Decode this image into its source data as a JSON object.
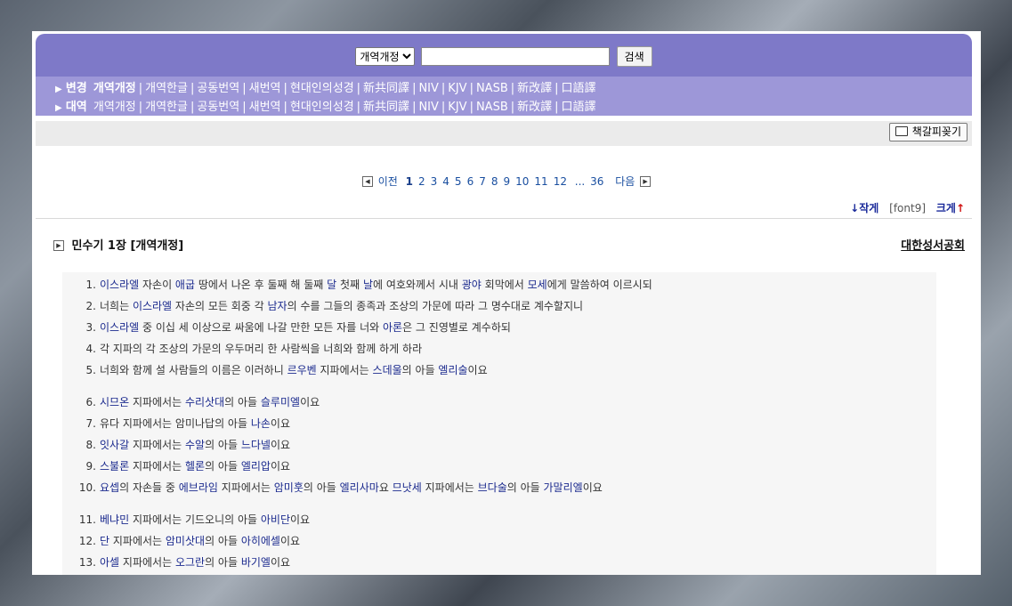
{
  "search": {
    "version_options": [
      "개역개정"
    ],
    "selected_version": "개역개정",
    "query": "",
    "button_label": "검색"
  },
  "nav": {
    "row1_label": "변경",
    "row1_selected": "개역개정",
    "row2_label": "대역",
    "versions": [
      "개역개정",
      "개역한글",
      "공동번역",
      "새번역",
      "현대인의성경",
      "新共同譯",
      "NIV",
      "KJV",
      "NASB",
      "新改譯",
      "口語譯"
    ]
  },
  "bookmark_label": "책갈피꽂기",
  "pager": {
    "prev": "이전",
    "pages": [
      "1",
      "2",
      "3",
      "4",
      "5",
      "6",
      "7",
      "8",
      "9",
      "10",
      "11",
      "12"
    ],
    "ellipsis": "...",
    "last": "36",
    "next": "다음",
    "current": "1"
  },
  "font_control": {
    "smaller": "↓작게",
    "current": "[font9]",
    "bigger": "크게"
  },
  "chapter_title": "민수기 1장 [개역개정]",
  "publisher": "대한성서공회",
  "verses": [
    {
      "num": "1.",
      "parts": [
        [
          "이스라엘",
          1
        ],
        [
          " 자손이 ",
          0
        ],
        [
          "애굽",
          1
        ],
        [
          " 땅에서 나온 후 둘째 해 둘째 ",
          0
        ],
        [
          "달",
          1
        ],
        [
          " 첫째 ",
          0
        ],
        [
          "날",
          1
        ],
        [
          "에 여호와께서 시내 ",
          0
        ],
        [
          "광야",
          1
        ],
        [
          " 회막에서 ",
          0
        ],
        [
          "모세",
          1
        ],
        [
          "에게 말씀하여 이르시되",
          0
        ]
      ]
    },
    {
      "num": "2.",
      "parts": [
        [
          "너희는 ",
          0
        ],
        [
          "이스라엘",
          1
        ],
        [
          " 자손의 모든 회중 각 ",
          0
        ],
        [
          "남자",
          1
        ],
        [
          "의 수를 그들의 종족과 조상의 가문에 따라 그 명수대로 계수할지니",
          0
        ]
      ]
    },
    {
      "num": "3.",
      "parts": [
        [
          "이스라엘",
          1
        ],
        [
          " 중 이십 세 이상으로 싸움에 나갈 만한 모든 자를 너와 ",
          0
        ],
        [
          "아론",
          1
        ],
        [
          "은 그 진영별로 계수하되",
          0
        ]
      ]
    },
    {
      "num": "4.",
      "parts": [
        [
          "각 지파의 각 조상의 가문의 우두머리 한 사람씩을 너희와 함께 하게 하라",
          0
        ]
      ]
    },
    {
      "num": "5.",
      "parts": [
        [
          "너희와 함께 설 사람들의 이름은 이러하니 ",
          0
        ],
        [
          "르우벤",
          1
        ],
        [
          " 지파에서는 ",
          0
        ],
        [
          "스데울",
          1
        ],
        [
          "의 아들 ",
          0
        ],
        [
          "엘리술",
          1
        ],
        [
          "이요",
          0
        ]
      ]
    },
    {
      "num": "6.",
      "parts": [
        [
          "시므온",
          1
        ],
        [
          " 지파에서는 ",
          0
        ],
        [
          "수리삿대",
          1
        ],
        [
          "의 아들 ",
          0
        ],
        [
          "슬루미엘",
          1
        ],
        [
          "이요",
          0
        ]
      ]
    },
    {
      "num": "7.",
      "parts": [
        [
          "유다 지파에서는 암미나답의 아들 ",
          0
        ],
        [
          "나손",
          1
        ],
        [
          "이요",
          0
        ]
      ]
    },
    {
      "num": "8.",
      "parts": [
        [
          "잇사갈",
          1
        ],
        [
          " 지파에서는 ",
          0
        ],
        [
          "수알",
          1
        ],
        [
          "의 아들 ",
          0
        ],
        [
          "느다넬",
          1
        ],
        [
          "이요",
          0
        ]
      ]
    },
    {
      "num": "9.",
      "parts": [
        [
          "스불론",
          1
        ],
        [
          " 지파에서는 ",
          0
        ],
        [
          "헬론",
          1
        ],
        [
          "의 아들 ",
          0
        ],
        [
          "엘리압",
          1
        ],
        [
          "이요",
          0
        ]
      ]
    },
    {
      "num": "10.",
      "parts": [
        [
          "요셉",
          1
        ],
        [
          "의 자손들 중 ",
          0
        ],
        [
          "에브라임",
          1
        ],
        [
          " 지파에서는 ",
          0
        ],
        [
          "암미훗",
          1
        ],
        [
          "의 아들 ",
          0
        ],
        [
          "엘리사마",
          1
        ],
        [
          "요 ",
          0
        ],
        [
          "므낫세",
          1
        ],
        [
          " 지파에서는 ",
          0
        ],
        [
          "브다술",
          1
        ],
        [
          "의 아들 ",
          0
        ],
        [
          "가말리엘",
          1
        ],
        [
          "이요",
          0
        ]
      ]
    },
    {
      "num": "11.",
      "parts": [
        [
          "베냐민",
          1
        ],
        [
          " 지파에서는 기드오니의 아들 ",
          0
        ],
        [
          "아비단",
          1
        ],
        [
          "이요",
          0
        ]
      ]
    },
    {
      "num": "12.",
      "parts": [
        [
          "단",
          1
        ],
        [
          " 지파에서는 ",
          0
        ],
        [
          "암미삿대",
          1
        ],
        [
          "의 아들 ",
          0
        ],
        [
          "아히에셀",
          1
        ],
        [
          "이요",
          0
        ]
      ]
    },
    {
      "num": "13.",
      "parts": [
        [
          "아셀",
          1
        ],
        [
          " 지파에서는 ",
          0
        ],
        [
          "오그란",
          1
        ],
        [
          "의 아들 ",
          0
        ],
        [
          "바기엘",
          1
        ],
        [
          "이요",
          0
        ]
      ]
    }
  ]
}
